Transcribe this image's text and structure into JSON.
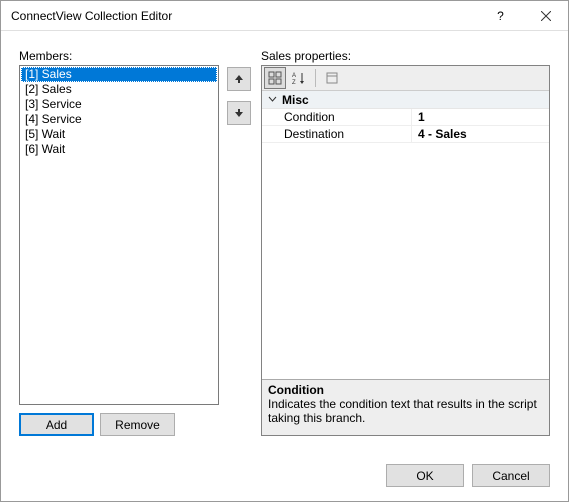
{
  "title": "ConnectView Collection Editor",
  "members_label": "Members:",
  "members": [
    {
      "label": "[1] Sales",
      "selected": true
    },
    {
      "label": "[2] Sales",
      "selected": false
    },
    {
      "label": "[3] Service",
      "selected": false
    },
    {
      "label": "[4] Service",
      "selected": false
    },
    {
      "label": "[5] Wait",
      "selected": false
    },
    {
      "label": "[6] Wait",
      "selected": false
    }
  ],
  "buttons": {
    "add": "Add",
    "remove": "Remove",
    "ok": "OK",
    "cancel": "Cancel"
  },
  "props_label": "Sales properties:",
  "property_grid": {
    "category": "Misc",
    "rows": [
      {
        "name": "Condition",
        "value": "1"
      },
      {
        "name": "Destination",
        "value": "4 - Sales"
      }
    ],
    "description": {
      "title": "Condition",
      "text": "Indicates the condition text that results in the script taking this branch."
    }
  }
}
